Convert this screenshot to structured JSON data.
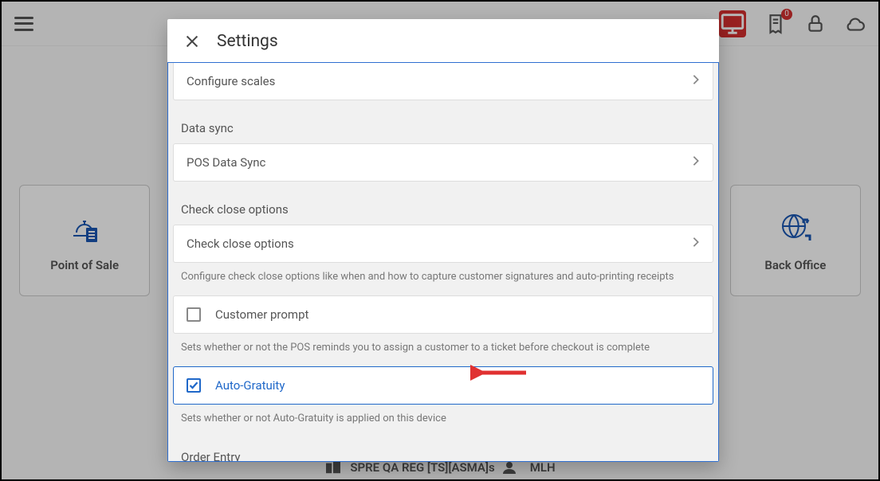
{
  "header": {
    "notification_count": "0"
  },
  "tiles": {
    "pos": "Point of Sale",
    "back_office": "Back Office"
  },
  "bottom_strip": {
    "left": "SPRE QA REG [TS][ASMA]s",
    "right": "MLH"
  },
  "modal": {
    "title": "Settings",
    "rows": {
      "configure_scales": "Configure scales",
      "pos_data_sync": "POS Data Sync",
      "check_close_options": "Check close options",
      "customer_prompt": "Customer prompt",
      "auto_gratuity": "Auto-Gratuity"
    },
    "sections": {
      "data_sync": "Data sync",
      "check_close": "Check close options",
      "order_entry": "Order Entry"
    },
    "helpers": {
      "check_close": "Configure check close options like when and how to capture customer signatures and auto-printing receipts",
      "customer_prompt": "Sets whether or not the POS reminds you to assign a customer to a ticket before checkout is complete",
      "auto_gratuity": "Sets whether or not Auto-Gratuity is applied on this device"
    }
  }
}
